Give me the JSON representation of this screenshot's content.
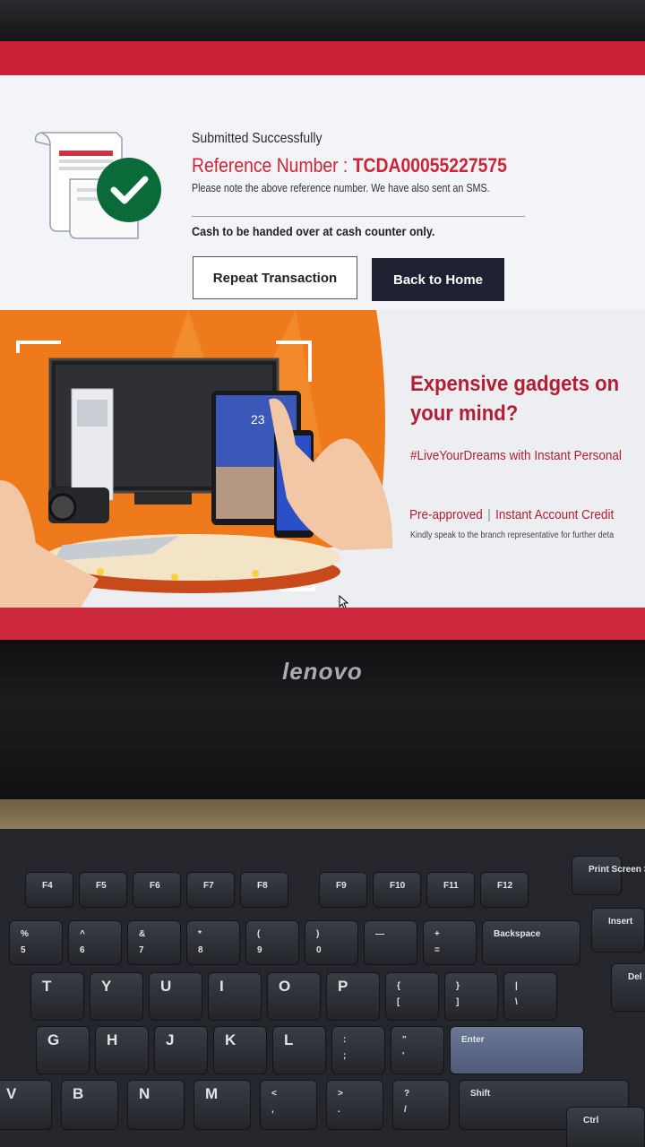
{
  "confirmation": {
    "title": "Submitted Successfully",
    "reference_label": "Reference Number : ",
    "reference_number": "TCDA00055227575",
    "note": "Please note the above reference number. We have also sent an SMS.",
    "cash_note": "Cash to be handed over at cash counter only.",
    "repeat_button": "Repeat Transaction",
    "home_button": "Back to Home"
  },
  "promo": {
    "headline": "Expensive gadgets on your mind?",
    "hashtag": "#LiveYourDreams with Instant Personal",
    "pre_approved": "Pre-approved",
    "separator": "|",
    "instant_credit": "Instant Account Credit",
    "fine_print": "Kindly speak to the branch representative for further deta",
    "tablet_time": "23"
  },
  "monitor": {
    "brand": "lenovo"
  },
  "keyboard": {
    "function_keys": [
      "F4",
      "F5",
      "F6",
      "F7",
      "F8",
      "F9",
      "F10",
      "F11",
      "F12"
    ],
    "number_row": [
      "%\n5",
      "^\n6",
      "&\n7",
      "*\n8",
      "(\n9",
      ")\n0",
      "—",
      "+\n=",
      "Backspace"
    ],
    "top_row": [
      "T",
      "Y",
      "U",
      "I",
      "O",
      "P",
      "{\n[",
      "}\n]",
      "|\n\\"
    ],
    "home_row": [
      "G",
      "H",
      "J",
      "K",
      "L",
      ":\n;",
      "\"\n'",
      "Enter"
    ],
    "bottom_row": [
      "V",
      "B",
      "N",
      "M",
      "<\n,",
      ">\n.",
      "?\n/",
      "Shift"
    ],
    "extra": [
      "Print Screen SysRq",
      "Insert",
      "Del",
      "Ctrl"
    ]
  },
  "colors": {
    "brand_red": "#c91f37",
    "headline_red": "#b31e34",
    "success_green": "#0b6a3a",
    "button_dark": "#1f2030",
    "promo_orange": "#ee7a1c"
  }
}
